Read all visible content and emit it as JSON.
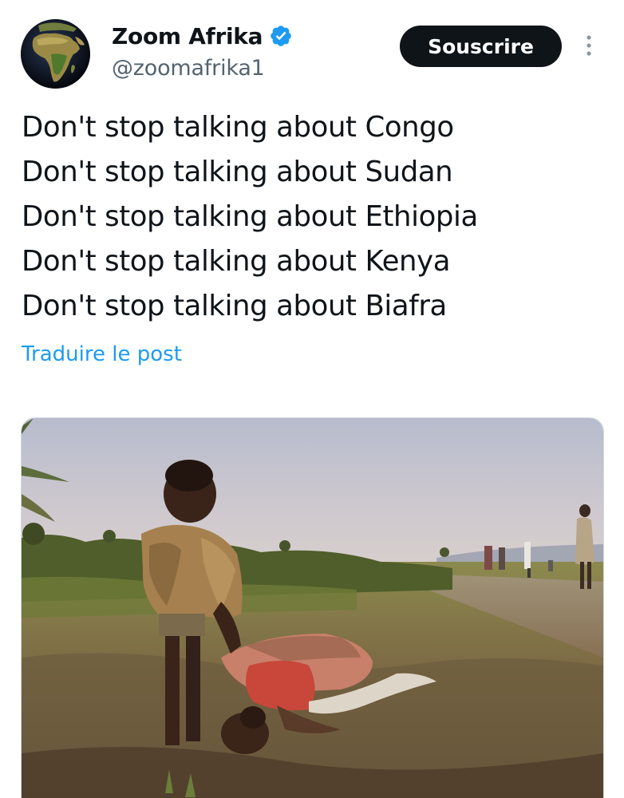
{
  "author": {
    "display_name": "Zoom Afrika",
    "handle": "@zoomafrika1",
    "avatar_icon": "africa-globe-icon",
    "verified_icon": "verified-badge-icon",
    "verified_color": "#1d9bf0"
  },
  "actions": {
    "subscribe_label": "Souscrire",
    "more_icon": "more-vertical-icon"
  },
  "post": {
    "lines": [
      "Don't stop talking about Congo",
      "Don't stop talking about Sudan",
      "Don't stop talking about Ethiopia",
      "Don't stop talking about Kenya",
      "Don't stop talking about Biafra"
    ],
    "translate_label": "Traduire le post"
  },
  "colors": {
    "text": "#0f1419",
    "secondary_text": "#536471",
    "link": "#1d9bf0",
    "button_bg": "#0f1419",
    "button_text": "#ffffff"
  }
}
